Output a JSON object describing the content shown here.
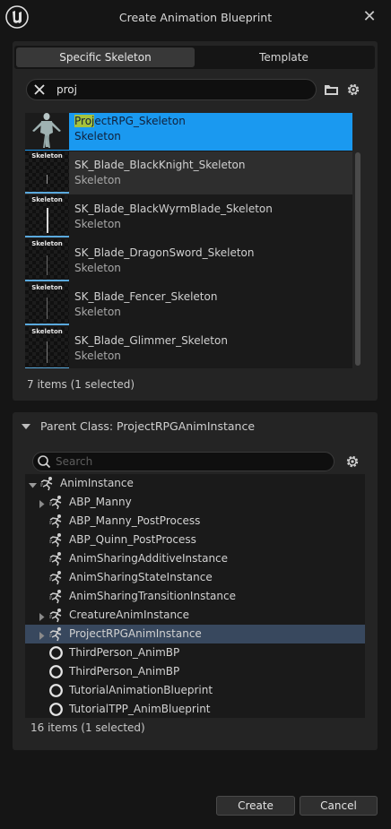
{
  "window": {
    "title": "Create Animation Blueprint"
  },
  "tabs": [
    {
      "label": "Specific Skeleton",
      "active": true
    },
    {
      "label": "Template",
      "active": false
    }
  ],
  "skeleton_search": {
    "match": "proj",
    "value": "proj"
  },
  "skeleton_list": {
    "items": [
      {
        "thumb_label": "",
        "name_highlight": "Proj",
        "name_rest": "ectRPG_Skeleton",
        "type": "Skeleton",
        "selected": true
      },
      {
        "thumb_label": "Skeleton",
        "name_highlight": "",
        "name_rest": "SK_Blade_BlackKnight_Skeleton",
        "type": "Skeleton",
        "selected": false
      },
      {
        "thumb_label": "Skeleton",
        "name_highlight": "",
        "name_rest": "SK_Blade_BlackWyrmBlade_Skeleton",
        "type": "Skeleton",
        "selected": false
      },
      {
        "thumb_label": "Skeleton",
        "name_highlight": "",
        "name_rest": "SK_Blade_DragonSword_Skeleton",
        "type": "Skeleton",
        "selected": false
      },
      {
        "thumb_label": "Skeleton",
        "name_highlight": "",
        "name_rest": "SK_Blade_Fencer_Skeleton",
        "type": "Skeleton",
        "selected": false
      },
      {
        "thumb_label": "Skeleton",
        "name_highlight": "",
        "name_rest": "SK_Blade_Glimmer_Skeleton",
        "type": "Skeleton",
        "selected": false
      }
    ],
    "count_text": "7 items (1 selected)"
  },
  "parent_class": {
    "label": "Parent Class: ProjectRPGAnimInstance",
    "search_placeholder": "Search",
    "tree": [
      {
        "label": "AnimInstance",
        "expanded": true,
        "icon": "anim-instance-icon"
      },
      {
        "label": "ABP_Manny",
        "expandable": true,
        "icon": "anim-instance-icon"
      },
      {
        "label": "ABP_Manny_PostProcess",
        "icon": "anim-instance-icon"
      },
      {
        "label": "ABP_Quinn_PostProcess",
        "icon": "anim-instance-icon"
      },
      {
        "label": "AnimSharingAdditiveInstance",
        "icon": "anim-instance-icon"
      },
      {
        "label": "AnimSharingStateInstance",
        "icon": "anim-instance-icon"
      },
      {
        "label": "AnimSharingTransitionInstance",
        "icon": "anim-instance-icon"
      },
      {
        "label": "CreatureAnimInstance",
        "expandable": true,
        "icon": "anim-instance-icon"
      },
      {
        "label": "ProjectRPGAnimInstance",
        "expandable": true,
        "selected": true,
        "icon": "anim-instance-icon"
      },
      {
        "label": "ThirdPerson_AnimBP",
        "icon": "circle-icon"
      },
      {
        "label": "ThirdPerson_AnimBP",
        "icon": "circle-icon"
      },
      {
        "label": "TutorialAnimationBlueprint",
        "icon": "circle-icon"
      },
      {
        "label": "TutorialTPP_AnimBlueprint",
        "icon": "circle-icon"
      }
    ],
    "count_text": "16 items (1 selected)"
  },
  "buttons": {
    "create": "Create",
    "cancel": "Cancel"
  },
  "colors": {
    "accent_selected": "#1a99f0",
    "search_highlight": "#a6c23c",
    "tree_selected": "#38485e"
  }
}
